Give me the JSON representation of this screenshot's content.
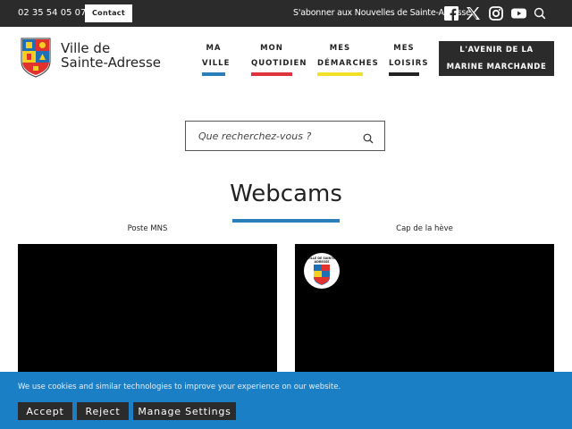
{
  "topbar": {
    "phone": "02 35 54 05 07",
    "contact_label": "Contact",
    "newsletter": "S'abonner aux Nouvelles de Sainte-Adresse",
    "social_icons": [
      "facebook-icon",
      "x-icon",
      "instagram-icon",
      "youtube-icon",
      "search-icon"
    ]
  },
  "header": {
    "site_name_line1": "Ville de",
    "site_name_line2": "Sainte-Adresse",
    "nav": [
      {
        "line1": "MA",
        "line2": "VILLE",
        "color": "#2a7fba"
      },
      {
        "line1": "MON",
        "line2": "QUOTIDIEN",
        "color": "#e0343c"
      },
      {
        "line1": "MES",
        "line2": "DÉMARCHES",
        "color": "#f2e12b"
      },
      {
        "line1": "MES",
        "line2": "LOISIRS",
        "color": "#222222"
      }
    ],
    "cta_line1": "L'AVENIR DE LA",
    "cta_line2": "MARINE MARCHANDE"
  },
  "search": {
    "placeholder": "Que recherchez-vous ?",
    "icon": "search-icon"
  },
  "main": {
    "title": "Webcams",
    "accent": "#2a7fba",
    "webcams": [
      {
        "label": "Poste MNS"
      },
      {
        "label": "Cap de la hève",
        "badge_text": "VILLE DE SAINTE-ADRESSE"
      }
    ]
  },
  "cookie_banner": {
    "message": "We use cookies and similar technologies to improve your experience on our website.",
    "accept": "Accept",
    "reject": "Reject",
    "manage": "Manage Settings",
    "background": "#1b7fc6"
  }
}
